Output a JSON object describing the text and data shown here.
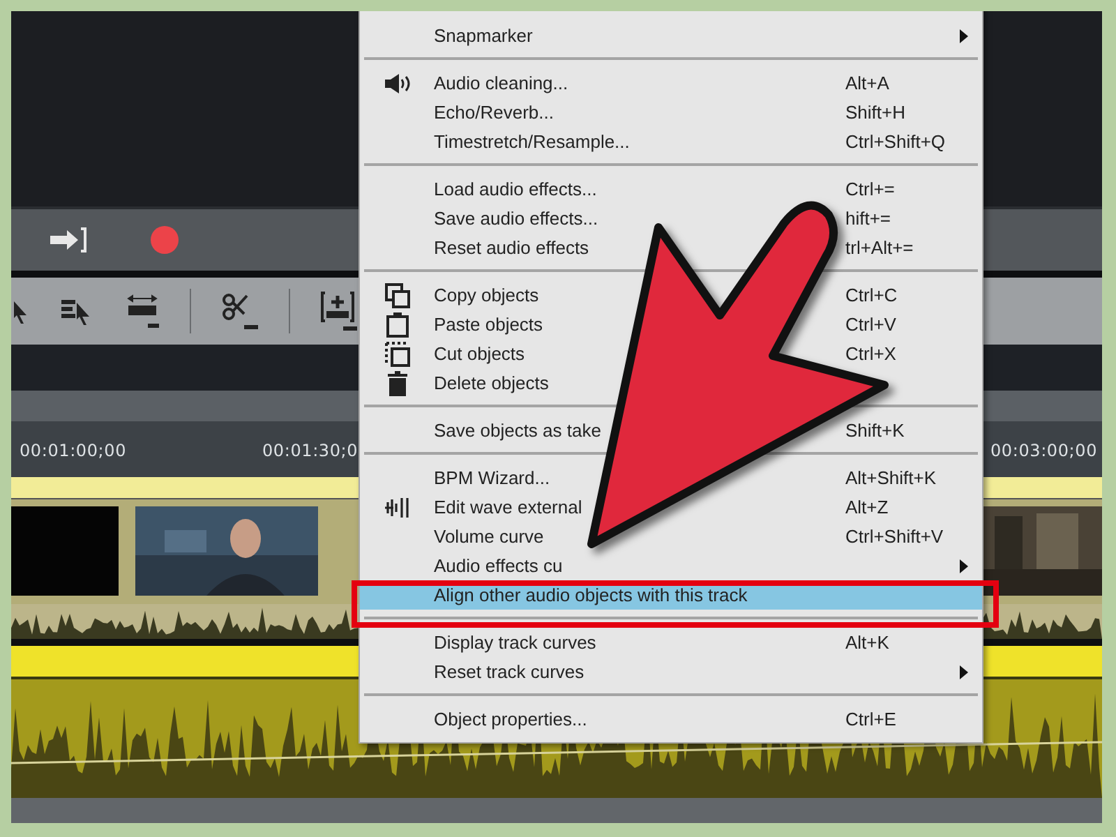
{
  "ruler": {
    "timecodes": [
      "00:01:00;00",
      "00:01:30;0",
      "00:03:00;00"
    ]
  },
  "context_menu": {
    "groups": [
      [
        {
          "label": "Snapmarker",
          "submenu": true,
          "selected": false
        }
      ],
      [
        {
          "label": "Audio cleaning...",
          "shortcut": "Alt+A",
          "submenu": false,
          "selected": false
        },
        {
          "label": "Echo/Reverb...",
          "shortcut": "Shift+H",
          "submenu": false,
          "selected": false
        },
        {
          "label": "Timestretch/Resample...",
          "shortcut": "Ctrl+Shift+Q",
          "submenu": false,
          "selected": false
        }
      ],
      [
        {
          "label": "Load audio effects...",
          "shortcut": "Ctrl+=",
          "submenu": false,
          "selected": false
        },
        {
          "label": "Save audio effects...",
          "shortcut": "hift+=",
          "submenu": false,
          "selected": false
        },
        {
          "label": "Reset audio effects",
          "shortcut": "trl+Alt+=",
          "submenu": false,
          "selected": false
        }
      ],
      [
        {
          "label": "Copy objects",
          "shortcut": "Ctrl+C",
          "submenu": false,
          "selected": false
        },
        {
          "label": "Paste objects",
          "shortcut": "Ctrl+V",
          "submenu": false,
          "selected": false
        },
        {
          "label": "Cut objects",
          "shortcut": "Ctrl+X",
          "submenu": false,
          "selected": false
        },
        {
          "label": "Delete objects",
          "submenu": false,
          "selected": false
        }
      ],
      [
        {
          "label": "Save objects as take",
          "shortcut": "Shift+K",
          "submenu": false,
          "selected": false
        }
      ],
      [
        {
          "label": "BPM Wizard...",
          "shortcut": "Alt+Shift+K",
          "submenu": false,
          "selected": false
        },
        {
          "label": "Edit wave external",
          "shortcut": "Alt+Z",
          "submenu": false,
          "selected": false
        },
        {
          "label": "Volume curve",
          "shortcut": "Ctrl+Shift+V",
          "submenu": false,
          "selected": false
        },
        {
          "label": "Audio effects cu",
          "submenu": true,
          "selected": false
        },
        {
          "label": "Align other audio objects with this track",
          "submenu": false,
          "selected": true
        }
      ],
      [
        {
          "label": "Display track curves",
          "shortcut": "Alt+K",
          "submenu": false,
          "selected": false
        },
        {
          "label": "Reset track curves",
          "submenu": true,
          "selected": false
        }
      ],
      [
        {
          "label": "Object properties...",
          "shortcut": "Ctrl+E",
          "submenu": false,
          "selected": false
        }
      ]
    ]
  }
}
